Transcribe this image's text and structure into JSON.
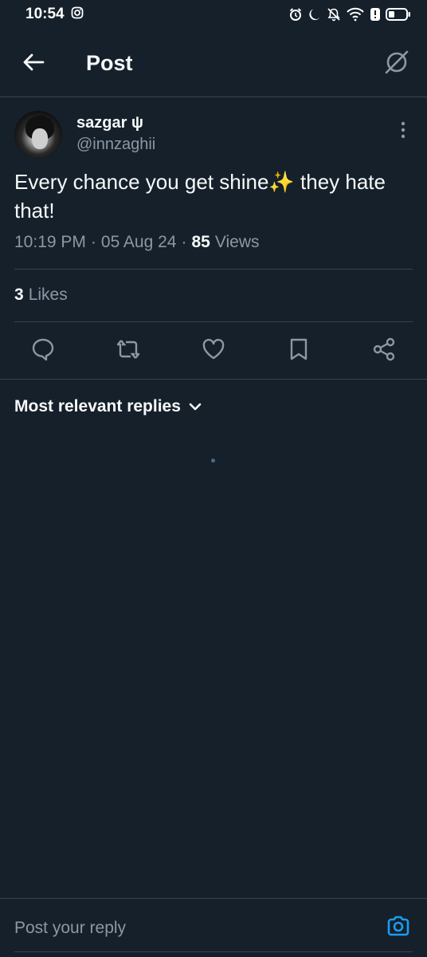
{
  "status_bar": {
    "time": "10:54",
    "icons": [
      "instagram-icon",
      "alarm-icon",
      "moon-icon",
      "bell-off-icon",
      "wifi-icon",
      "alert-icon",
      "battery-icon"
    ]
  },
  "header": {
    "title": "Post",
    "back_icon": "arrow-left-icon",
    "grok_icon": "grok-icon"
  },
  "post": {
    "author_name": "sazgar ψ",
    "author_handle": "@innzaghii",
    "text": "Every chance you get shine✨ they hate that!",
    "time": "10:19 PM",
    "sep1": "·",
    "date": "05 Aug 24",
    "sep2": "·",
    "views_count": "85",
    "views_label": "Views",
    "likes_count": "3",
    "likes_label": "Likes"
  },
  "actions": [
    "reply-icon",
    "repost-icon",
    "like-icon",
    "bookmark-icon",
    "share-icon"
  ],
  "replies": {
    "filter_label": "Most relevant replies"
  },
  "reply_bar": {
    "placeholder": "Post your reply"
  },
  "colors": {
    "background": "#15202b",
    "text": "#f7f9f9",
    "secondary": "#8b98a5",
    "divider": "#38444d",
    "accent": "#1d9bf0"
  }
}
